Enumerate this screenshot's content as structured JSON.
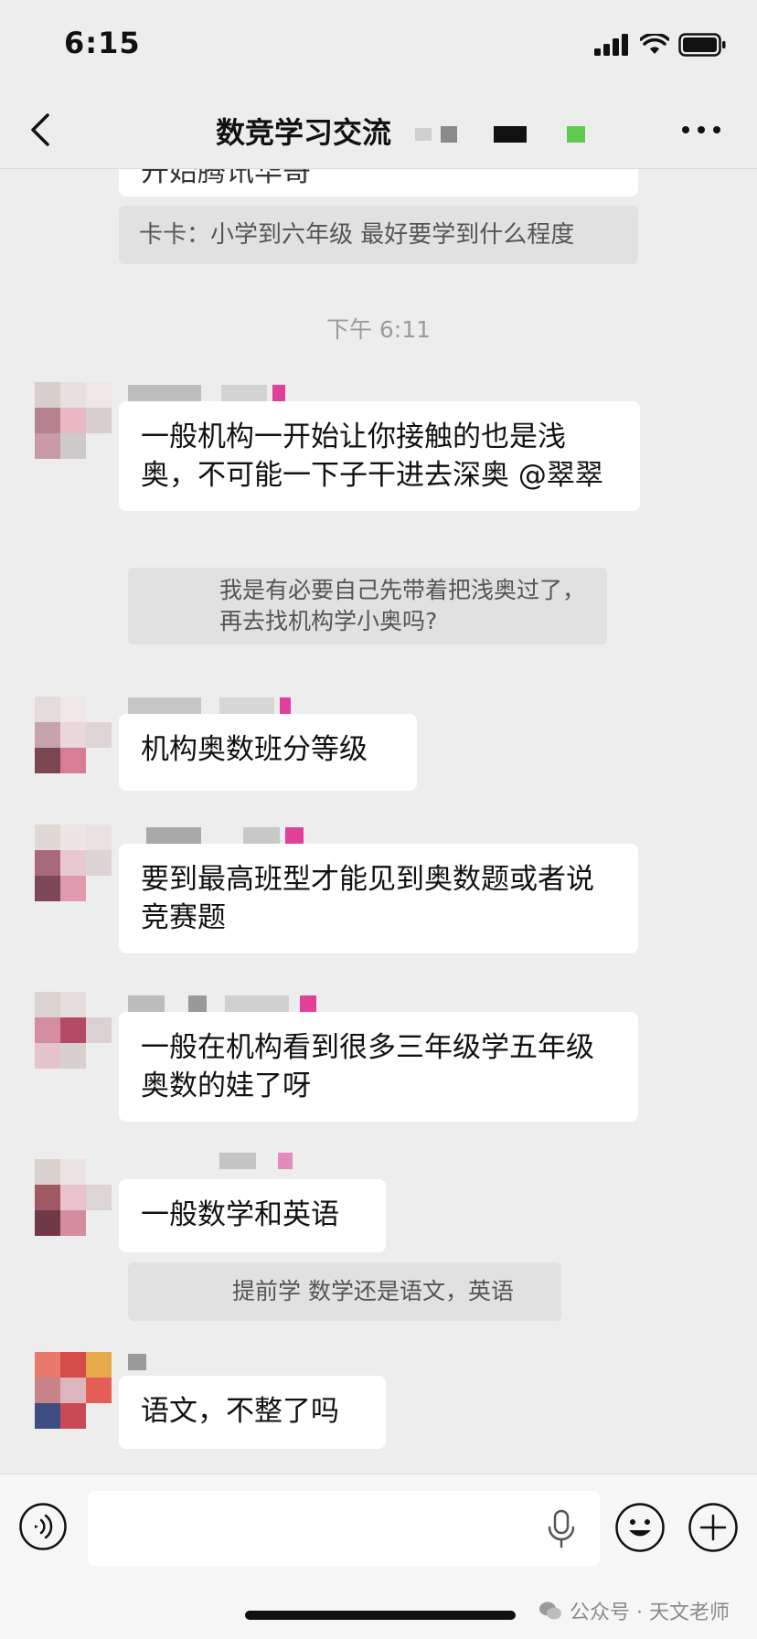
{
  "status": {
    "time": "6:15"
  },
  "nav": {
    "title": "数竞学习交流"
  },
  "messages": {
    "top_partial": "开始腾讯华哥",
    "quote1": "卡卡：小学到六年级 最好要学到什么程度",
    "time_divider": "下午 6:11",
    "msg1": "一般机构一开始让你接触的也是浅奥，不可能一下子干进去深奥 @翠翠",
    "quote2": "我是有必要自己先带着把浅奥过了，再去找机构学小奥吗?",
    "msg2": "机构奥数班分等级",
    "msg3": "要到最高班型才能见到奥数题或者说竞赛题",
    "msg4": "一般在机构看到很多三年级学五年级奥数的娃了呀",
    "msg5": "一般数学和英语",
    "quote3": "提前学 数学还是语文，英语",
    "msg6": "语文，不整了吗"
  },
  "watermark": {
    "text": "公众号 · 天文老师"
  },
  "colors": {
    "background": "#ededed",
    "bubble": "#ffffff",
    "quote": "#e1e1e1",
    "pink": "#e0409a",
    "green": "#5fcc4f"
  }
}
